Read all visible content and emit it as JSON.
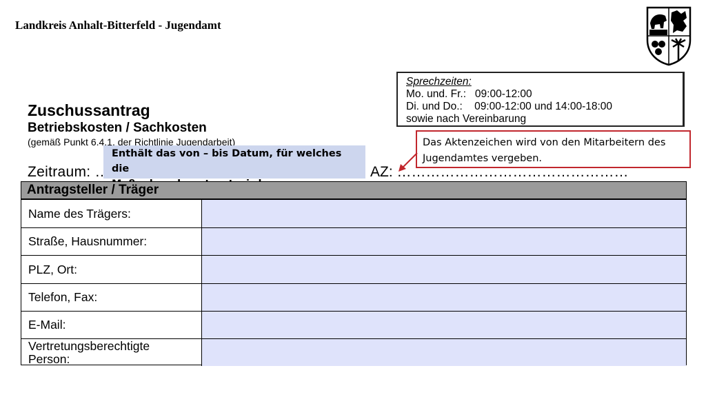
{
  "header": {
    "title": "Landkreis Anhalt-Bitterfeld - Jugendamt"
  },
  "office_hours": {
    "title": "Sprechzeiten:",
    "lines": [
      "Mo. und. Fr.:   09:00-12:00",
      "Di. und Do.:    09:00-12:00 und 14:00-18:00",
      "sowie nach Vereinbarung"
    ]
  },
  "form": {
    "title": "Zuschussantrag",
    "subtitle": "Betriebskosten / Sachkosten",
    "note": "(gemäß Punkt 6.4.1. der Richtlinie Jugendarbeit)",
    "period_label": "Zeitraum:",
    "period_dots": "……………………………………………",
    "az_label": "AZ:",
    "az_dots": "…………………………………………",
    "section_header": "Antragsteller / Träger",
    "fields": [
      {
        "label": "Name des Trägers:",
        "value": ""
      },
      {
        "label": "Straße, Hausnummer:",
        "value": ""
      },
      {
        "label": "PLZ, Ort:",
        "value": ""
      },
      {
        "label": "Telefon, Fax:",
        "value": ""
      },
      {
        "label": "E-Mail:",
        "value": ""
      },
      {
        "label_line1": "Vertretungsberechtigte",
        "label_line2": "Person:",
        "value": ""
      }
    ]
  },
  "annotations": {
    "period_note_line1": "Enthält das von – bis Datum, für welches die",
    "period_note_line2": "Maßnahme beantragt wird",
    "az_note_line1": "Das Aktenzeichen wird von den Mitarbeitern des",
    "az_note_line2": "Jugendamtes vergeben."
  },
  "colors": {
    "callout_border": "#c1272d",
    "callout_fill": "#cdd6ee",
    "field_fill": "#dfe3fb",
    "section_header_fill": "#9b9b9b"
  }
}
